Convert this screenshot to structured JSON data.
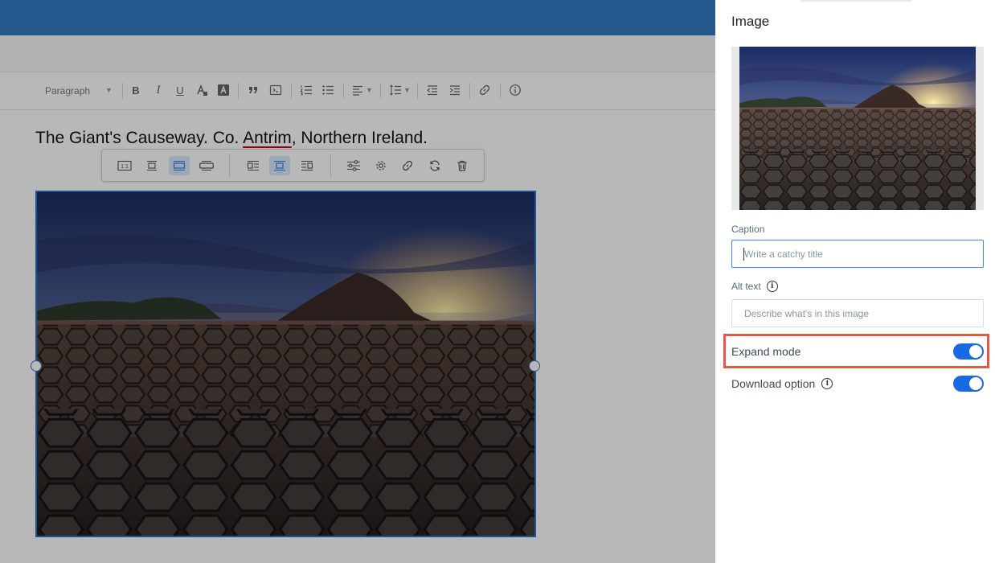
{
  "editor": {
    "toolbar": {
      "paragraph_style": "Paragraph",
      "bold": "B",
      "italic": "I",
      "underline": "U"
    },
    "content_title": {
      "part1": "The Giant's Causeway. Co. ",
      "part2": "Antrim",
      "part3": ", Northern Ireland."
    },
    "image_toolbar": {
      "original_size": "1:1"
    }
  },
  "panel": {
    "title": "Image",
    "caption": {
      "label": "Caption",
      "placeholder": "Write a catchy title",
      "value": ""
    },
    "alt_text": {
      "label": "Alt text",
      "placeholder": "Describe what's in this image",
      "value": ""
    },
    "expand_mode": {
      "label": "Expand mode",
      "enabled": true
    },
    "download_option": {
      "label": "Download option",
      "enabled": true
    }
  },
  "colors": {
    "topbar": "#3379c2",
    "accent": "#1769e6",
    "highlight": "#e05a43",
    "selection": "#2b73c4"
  },
  "icons": {
    "info": "info-icon",
    "bold": "bold-icon",
    "italic": "italic-icon",
    "underline": "underline-icon",
    "link": "link-icon",
    "settings": "gear-icon",
    "delete": "trash-icon"
  }
}
